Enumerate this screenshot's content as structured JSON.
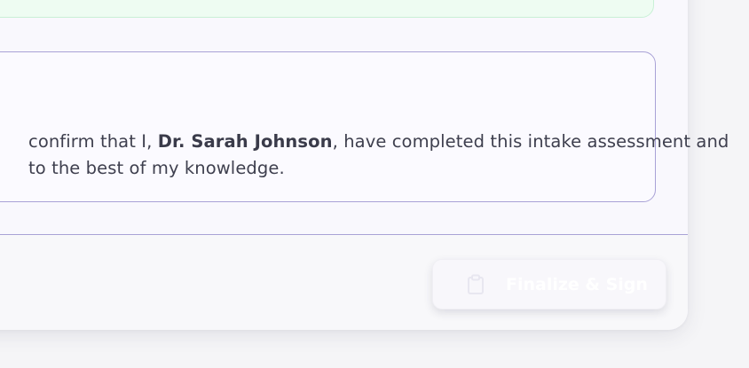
{
  "attestation": {
    "line1_prefix": "confirm that I, ",
    "doctor_name": "Dr. Sarah Johnson",
    "line1_suffix": ", have completed this intake assessment and",
    "line2": "to the best of my knowledge."
  },
  "footer": {
    "finalize_label": "Finalize & Sign",
    "finalize_icon": "clipboard-icon"
  },
  "colors": {
    "success_bg": "#eefcf2",
    "accent_border": "#a9a2d6",
    "text": "#3e3f4e"
  }
}
